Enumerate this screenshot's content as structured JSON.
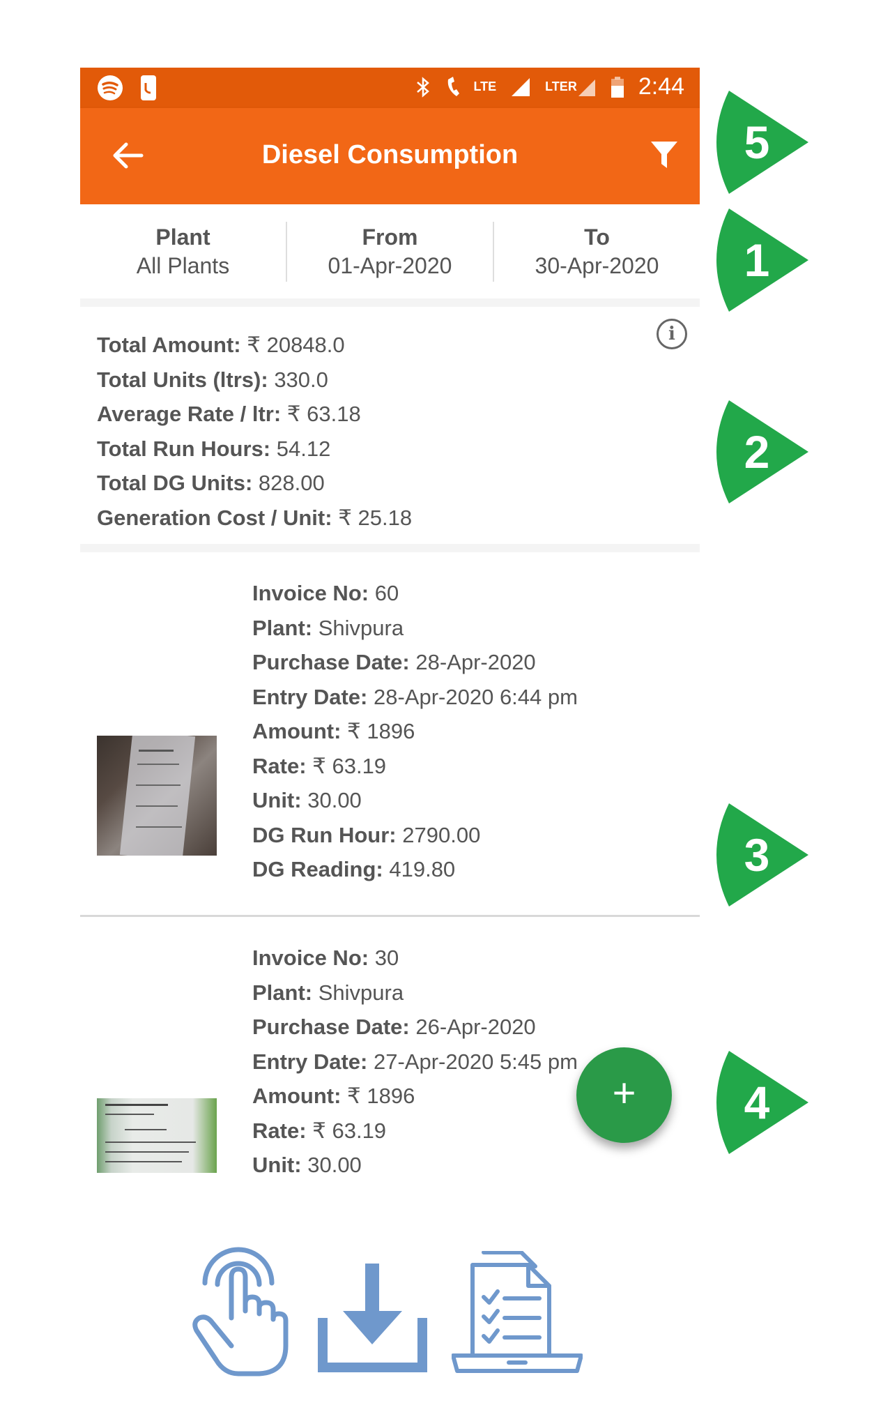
{
  "status_bar": {
    "time": "2:44",
    "lte_label": "LTE",
    "lte2_label": "LTE",
    "roaming": "R"
  },
  "app_bar": {
    "title": "Diesel Consumption"
  },
  "filters": [
    {
      "label": "Plant",
      "value": "All Plants"
    },
    {
      "label": "From",
      "value": "01-Apr-2020"
    },
    {
      "label": "To",
      "value": "30-Apr-2020"
    }
  ],
  "summary": [
    {
      "label": "Total Amount:",
      "value": "₹ 20848.0"
    },
    {
      "label": "Total Units (ltrs):",
      "value": "330.0"
    },
    {
      "label": "Average Rate / ltr:",
      "value": "₹ 63.18"
    },
    {
      "label": "Total Run Hours:",
      "value": "54.12"
    },
    {
      "label": "Total DG Units:",
      "value": "828.00"
    },
    {
      "label": "Generation Cost / Unit:",
      "value": "₹ 25.18"
    }
  ],
  "entries": [
    {
      "fields": [
        {
          "label": "Invoice No:",
          "value": "60"
        },
        {
          "label": "Plant:",
          "value": "Shivpura"
        },
        {
          "label": "Purchase Date:",
          "value": "28-Apr-2020"
        },
        {
          "label": "Entry Date:",
          "value": "28-Apr-2020 6:44 pm"
        },
        {
          "label": "Amount:",
          "value": "₹ 1896"
        },
        {
          "label": "Rate:",
          "value": "₹ 63.19"
        },
        {
          "label": "Unit:",
          "value": "30.00"
        },
        {
          "label": "DG Run Hour:",
          "value": "2790.00"
        },
        {
          "label": "DG Reading:",
          "value": "419.80"
        }
      ]
    },
    {
      "fields": [
        {
          "label": "Invoice No:",
          "value": "30"
        },
        {
          "label": "Plant:",
          "value": "Shivpura"
        },
        {
          "label": "Purchase Date:",
          "value": "26-Apr-2020"
        },
        {
          "label": "Entry Date:",
          "value": "27-Apr-2020 5:45 pm"
        },
        {
          "label": "Amount:",
          "value": "₹ 1896"
        },
        {
          "label": "Rate:",
          "value": "₹ 63.19"
        },
        {
          "label": "Unit:",
          "value": "30.00"
        }
      ]
    }
  ],
  "fab": {
    "symbol": "+"
  },
  "badges": [
    "5",
    "1",
    "2",
    "3",
    "4"
  ],
  "colors": {
    "status_bar": "#e25a09",
    "app_bar": "#f26716",
    "fab": "#2a9a48",
    "badge": "#22a84a",
    "bottom_icons": "#6f98cc"
  },
  "bottom_icons": [
    "touch-icon",
    "download-icon",
    "report-icon"
  ]
}
